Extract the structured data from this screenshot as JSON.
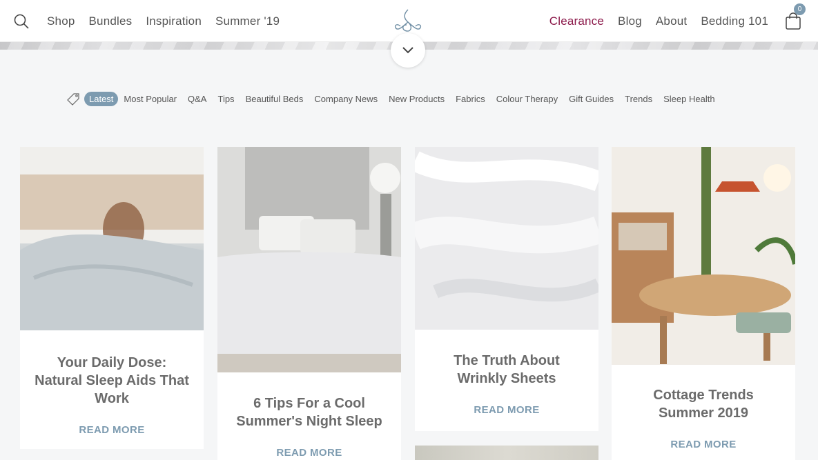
{
  "header": {
    "nav_left": [
      "Shop",
      "Bundles",
      "Inspiration",
      "Summer '19"
    ],
    "nav_right": [
      "Clearance",
      "Blog",
      "About",
      "Bedding 101"
    ],
    "cart_count": "0"
  },
  "categories": [
    "Latest",
    "Most Popular",
    "Q&A",
    "Tips",
    "Beautiful Beds",
    "Company News",
    "New Products",
    "Fabrics",
    "Colour Therapy",
    "Gift Guides",
    "Trends",
    "Sleep Health"
  ],
  "posts": [
    {
      "title": "Your Daily Dose: Natural Sleep Aids That Work",
      "cta": "READ MORE"
    },
    {
      "title": "6 Tips For a Cool Summer's Night Sleep",
      "cta": "READ MORE"
    },
    {
      "title": "The Truth About Wrinkly Sheets",
      "cta": "READ MORE"
    },
    {
      "title": "Cottage Trends Summer 2019",
      "cta": "READ MORE"
    }
  ],
  "colors": {
    "accent": "#7d9bb0",
    "clearance": "#8c1a4b",
    "background": "#f5f6f7"
  }
}
